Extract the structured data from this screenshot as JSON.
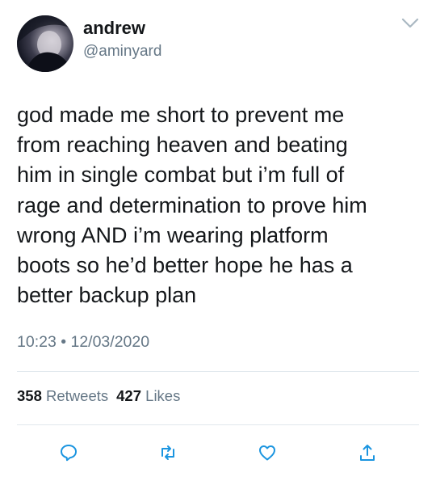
{
  "user": {
    "display_name": "andrew",
    "handle": "@aminyard"
  },
  "tweet": {
    "text": "god made me short to prevent me\nfrom reaching heaven and beating\nhim in single combat but i’m full of\nrage and determination to prove him\nwrong AND i’m wearing platform\nboots so he’d better hope he has a\nbetter backup plan",
    "time": "10:23",
    "separator": " • ",
    "date": "12/03/2020"
  },
  "stats": {
    "retweets_count": "358",
    "retweets_label": "Retweets",
    "likes_count": "427",
    "likes_label": "Likes"
  },
  "icons": {
    "menu": "chevron-down-icon",
    "reply": "reply-icon",
    "retweet": "retweet-icon",
    "like": "heart-icon",
    "share": "share-icon"
  },
  "colors": {
    "text": "#14171a",
    "muted": "#657786",
    "icon": "#1b95e0",
    "divider": "#e1e8ed"
  }
}
